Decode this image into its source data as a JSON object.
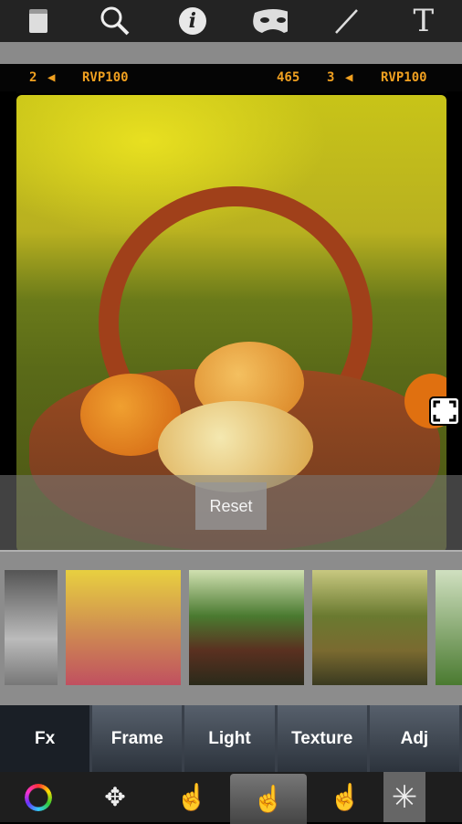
{
  "toolbar": {
    "icons": [
      "clipboard-icon",
      "search-icon",
      "info-icon",
      "mask-icon",
      "brush-icon",
      "text-icon"
    ],
    "text_icon_glyph": "T",
    "info_glyph": "i"
  },
  "film_strip": {
    "left_frame": "2",
    "left_code": "RVP100",
    "counter": "465",
    "right_frame": "3",
    "right_code": "RVP100"
  },
  "photo": {
    "reset_label": "Reset"
  },
  "filters": [
    "black-and-white",
    "warm-pink",
    "dark-vintage",
    "olive-tone",
    "green-partial"
  ],
  "tabs": [
    {
      "label": "Fx",
      "active": true
    },
    {
      "label": "Frame"
    },
    {
      "label": "Light"
    },
    {
      "label": "Texture"
    },
    {
      "label": "Adj"
    }
  ],
  "bottom_tools": [
    "color-wheel-icon",
    "move-gesture-icon",
    "tap-gesture-icon",
    "color-tap-icon",
    "rotate-gesture-icon",
    "magic-wand-icon"
  ],
  "colors": {
    "accent": "#f0a020",
    "tab_bg": "#4a525e",
    "active_tab": "#1a1f26"
  }
}
